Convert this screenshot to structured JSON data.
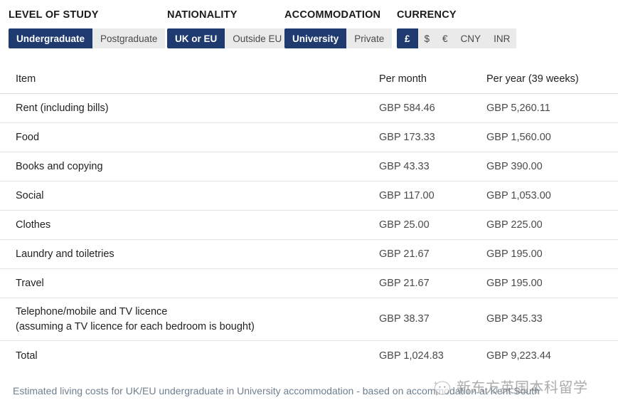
{
  "filters": [
    {
      "id": "level-of-study",
      "label": "LEVEL OF STUDY",
      "options": [
        {
          "label": "Undergraduate",
          "selected": true
        },
        {
          "label": "Postgraduate",
          "selected": false
        }
      ]
    },
    {
      "id": "nationality",
      "label": "NATIONALITY",
      "options": [
        {
          "label": "UK or EU",
          "selected": true
        },
        {
          "label": "Outside EU",
          "selected": false
        }
      ]
    },
    {
      "id": "accommodation",
      "label": "ACCOMMODATION",
      "options": [
        {
          "label": "University",
          "selected": true
        },
        {
          "label": "Private",
          "selected": false
        }
      ]
    },
    {
      "id": "currency",
      "label": "CURRENCY",
      "options": [
        {
          "label": "£",
          "selected": true
        },
        {
          "label": "$",
          "selected": false
        },
        {
          "label": "€",
          "selected": false
        },
        {
          "label": "CNY",
          "selected": false
        },
        {
          "label": "INR",
          "selected": false
        }
      ]
    }
  ],
  "table": {
    "columns": {
      "item": "Item",
      "per_month": "Per month",
      "per_year": "Per year (39 weeks)"
    },
    "rows": [
      {
        "item": "Rent (including bills)",
        "item_note": "",
        "per_month": "GBP 584.46",
        "per_year": "GBP 5,260.11"
      },
      {
        "item": "Food",
        "item_note": "",
        "per_month": "GBP 173.33",
        "per_year": "GBP 1,560.00"
      },
      {
        "item": "Books and copying",
        "item_note": "",
        "per_month": "GBP 43.33",
        "per_year": "GBP 390.00"
      },
      {
        "item": "Social",
        "item_note": "",
        "per_month": "GBP 117.00",
        "per_year": "GBP 1,053.00"
      },
      {
        "item": "Clothes",
        "item_note": "",
        "per_month": "GBP 25.00",
        "per_year": "GBP 225.00"
      },
      {
        "item": "Laundry and toiletries",
        "item_note": "",
        "per_month": "GBP 21.67",
        "per_year": "GBP 195.00"
      },
      {
        "item": "Travel",
        "item_note": "",
        "per_month": "GBP 21.67",
        "per_year": "GBP 195.00"
      },
      {
        "item": "Telephone/mobile and TV licence",
        "item_note": "(assuming a TV licence for each bedroom is bought)",
        "per_month": "GBP 38.37",
        "per_year": "GBP 345.33"
      }
    ],
    "total": {
      "item": "Total",
      "per_month": "GBP 1,024.83",
      "per_year": "GBP 9,223.44"
    }
  },
  "footnote": "Estimated living costs for UK/EU undergraduate in University accommodation - based on accommodation at Kent South",
  "watermark": {
    "text": "新东方英国本科留学"
  },
  "colors": {
    "accent_navy": "#1e3a6e",
    "segment_bg": "#eaeaea",
    "divider": "#e2e2e2",
    "footnote_text": "#6f7f8e",
    "value_text": "#4a4a4a"
  }
}
